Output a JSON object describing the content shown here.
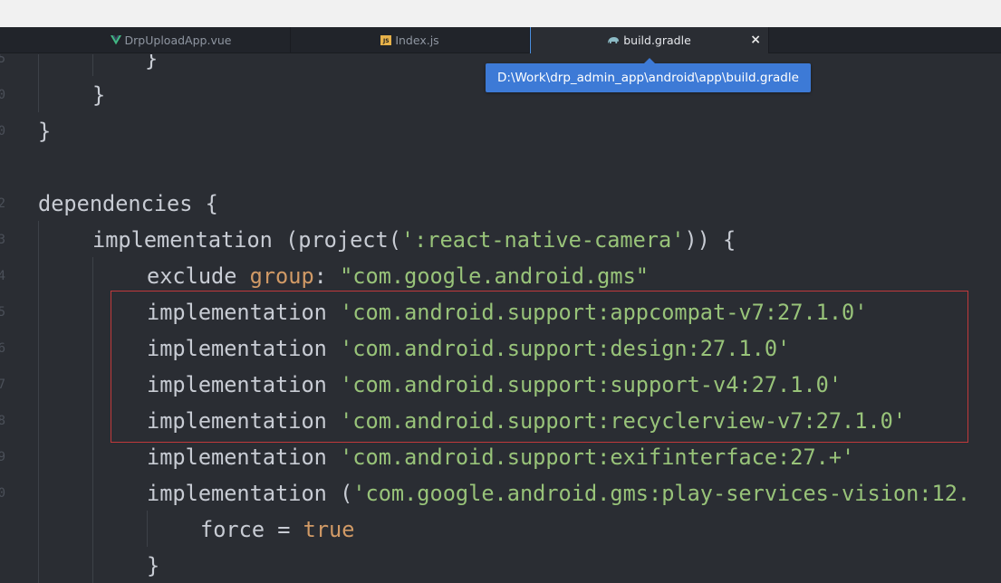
{
  "tabs": [
    {
      "label": "DrpUploadApp.vue",
      "icon": "vue-icon",
      "active": false
    },
    {
      "label": "Index.js",
      "icon": "js-file-icon",
      "icon_text": "JS",
      "active": false
    },
    {
      "label": "build.gradle",
      "icon": "gradle-elephant-icon",
      "active": true,
      "close_label": "×"
    }
  ],
  "tooltip": "D:\\Work\\drp_admin_app\\android\\app\\build.gradle",
  "colors": {
    "background": "#2a2d33",
    "string": "#98c379",
    "keyword": "#d19a66",
    "text": "#c8ccd4",
    "highlight_border": "#c0393b",
    "tooltip_bg": "#3d7ad6"
  },
  "gutter": [
    "5",
    "0",
    "0",
    "",
    "2",
    "3",
    "4",
    "5",
    "6",
    "7",
    "8",
    "9",
    "0",
    "",
    ""
  ],
  "code": {
    "l1": "}",
    "l2": "}",
    "l3": "}",
    "l5_a": "dependencies {",
    "l6_a": "implementation (project(",
    "l6_b": "':react-native-camera'",
    "l6_c": ")) {",
    "l7_a": "exclude ",
    "l7_b": "group",
    "l7_c": ": ",
    "l7_d": "\"com.google.android.gms\"",
    "l8_a": "implementation ",
    "l8_b": "'com.android.support:appcompat-v7:27.1.0'",
    "l9_a": "implementation ",
    "l9_b": "'com.android.support:design:27.1.0'",
    "l10_a": "implementation ",
    "l10_b": "'com.android.support:support-v4:27.1.0'",
    "l11_a": "implementation ",
    "l11_b": "'com.android.support:recyclerview-v7:27.1.0'",
    "l12_a": "implementation ",
    "l12_b": "'com.android.support:exifinterface:27.+'",
    "l13_a": "implementation (",
    "l13_b": "'com.google.android.gms:play-services-vision:12.",
    "l14_a": "force = ",
    "l14_b": "true",
    "l15": "}"
  }
}
